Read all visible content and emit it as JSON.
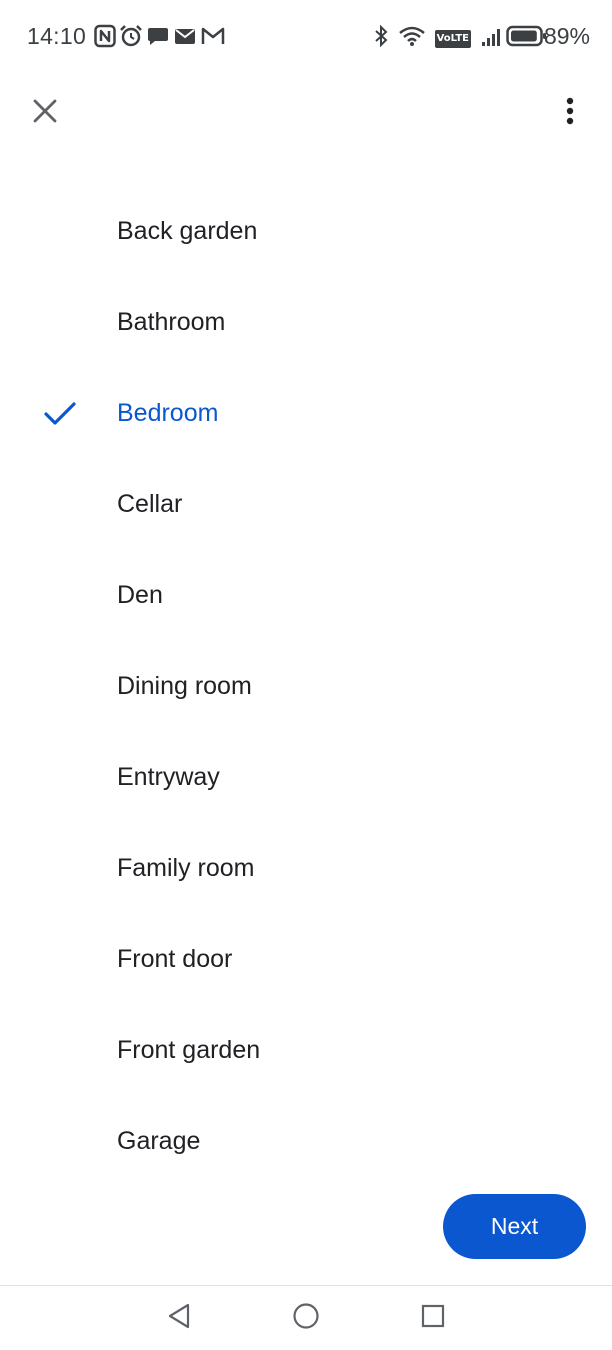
{
  "status_bar": {
    "time": "14:10",
    "battery_percent": "89%",
    "network_badge": "VoLTE",
    "battery_level": 0.89,
    "left_icons": [
      "nfc-icon",
      "alarm-icon",
      "chat-icon",
      "email-icon",
      "gmail-icon"
    ],
    "right_icons": [
      "bluetooth-icon",
      "wifi-icon",
      "volte-icon",
      "signal-icon",
      "battery-icon"
    ]
  },
  "top_bar": {
    "close_icon": "close-icon",
    "more_icon": "more-vert-icon"
  },
  "rooms": {
    "items": [
      {
        "label": "Back garden",
        "selected": false
      },
      {
        "label": "Bathroom",
        "selected": false
      },
      {
        "label": "Bedroom",
        "selected": true
      },
      {
        "label": "Cellar",
        "selected": false
      },
      {
        "label": "Den",
        "selected": false
      },
      {
        "label": "Dining room",
        "selected": false
      },
      {
        "label": "Entryway",
        "selected": false
      },
      {
        "label": "Family room",
        "selected": false
      },
      {
        "label": "Front door",
        "selected": false
      },
      {
        "label": "Front garden",
        "selected": false
      },
      {
        "label": "Garage",
        "selected": false
      }
    ]
  },
  "actions": {
    "next_label": "Next"
  },
  "nav_bar": {
    "back_icon": "back-icon",
    "home_icon": "home-icon",
    "recents_icon": "recents-icon"
  },
  "colors": {
    "accent": "#0b57d0",
    "text_primary": "#202124",
    "icon_grey": "#5f6368",
    "status_text": "#3c4043"
  }
}
